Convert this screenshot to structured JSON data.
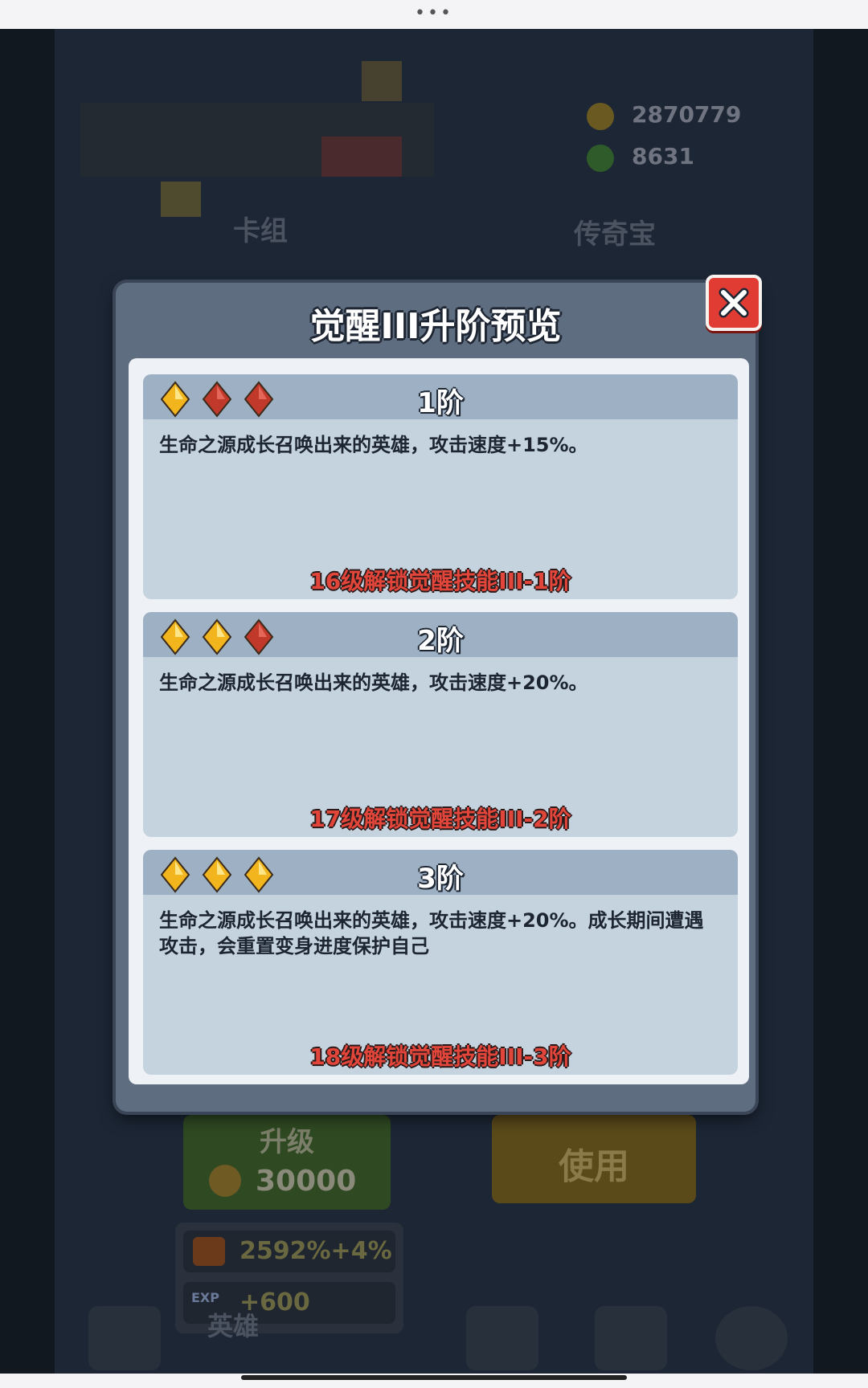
{
  "topbar": {
    "dots": "•••"
  },
  "background": {
    "coins": "2870779",
    "gems": "8631",
    "left_label": "卡组",
    "right_label": "传奇宝",
    "upgrade_label": "升级",
    "upgrade_cost": "30000",
    "use_label": "使用",
    "damage_stat": "2592%+4%",
    "exp_stat": "+600",
    "exp_badge": "EXP",
    "hero_tab": "英雄"
  },
  "dialog": {
    "title": "觉醒III升阶预览",
    "close_icon": "close-icon",
    "tiers": [
      {
        "title": "1阶",
        "gems": [
          "gold",
          "red",
          "red"
        ],
        "description": "生命之源成长召唤出来的英雄，攻击速度+15%。",
        "unlock": "16级解锁觉醒技能III-1阶"
      },
      {
        "title": "2阶",
        "gems": [
          "gold",
          "gold",
          "red"
        ],
        "description": "生命之源成长召唤出来的英雄，攻击速度+20%。",
        "unlock": "17级解锁觉醒技能III-2阶"
      },
      {
        "title": "3阶",
        "gems": [
          "gold",
          "gold",
          "gold"
        ],
        "description": "生命之源成长召唤出来的英雄，攻击速度+20%。成长期间遭遇攻击，会重置变身进度保护自己",
        "unlock": "18级解锁觉醒技能III-3阶"
      }
    ]
  },
  "colors": {
    "gem_gold": "#f2b51d",
    "gem_red": "#c0392b",
    "unlock_red": "#e2453a",
    "close_red": "#e03c33"
  }
}
